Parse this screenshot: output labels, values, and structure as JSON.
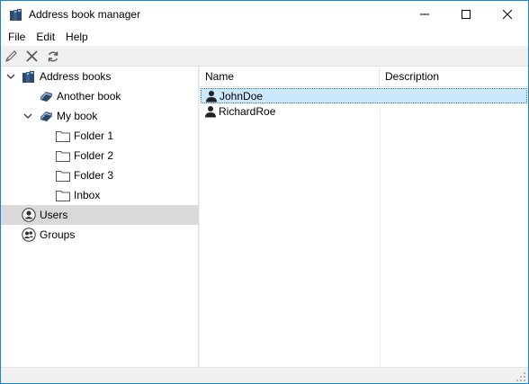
{
  "window": {
    "title": "Address book manager"
  },
  "menu": {
    "items": [
      "File",
      "Edit",
      "Help"
    ]
  },
  "toolbar": {
    "buttons": [
      "edit-icon",
      "delete-icon",
      "refresh-icon"
    ]
  },
  "tree": {
    "root": {
      "label": "Address books",
      "expanded": true
    },
    "books": [
      {
        "label": "Another book",
        "expanded": false
      },
      {
        "label": "My book",
        "expanded": true,
        "folders": [
          "Folder 1",
          "Folder 2",
          "Folder 3",
          "Inbox"
        ]
      }
    ],
    "users": {
      "label": "Users",
      "selected": true
    },
    "groups": {
      "label": "Groups"
    }
  },
  "list": {
    "columns": [
      "Name",
      "Description"
    ],
    "rows": [
      {
        "name": "JohnDoe",
        "description": "",
        "selected": true
      },
      {
        "name": "RichardRoe",
        "description": "",
        "selected": false
      }
    ]
  },
  "colors": {
    "accent": "#1883d7",
    "selection": "#cce8ff",
    "tree_selection": "#d9d9d9"
  }
}
